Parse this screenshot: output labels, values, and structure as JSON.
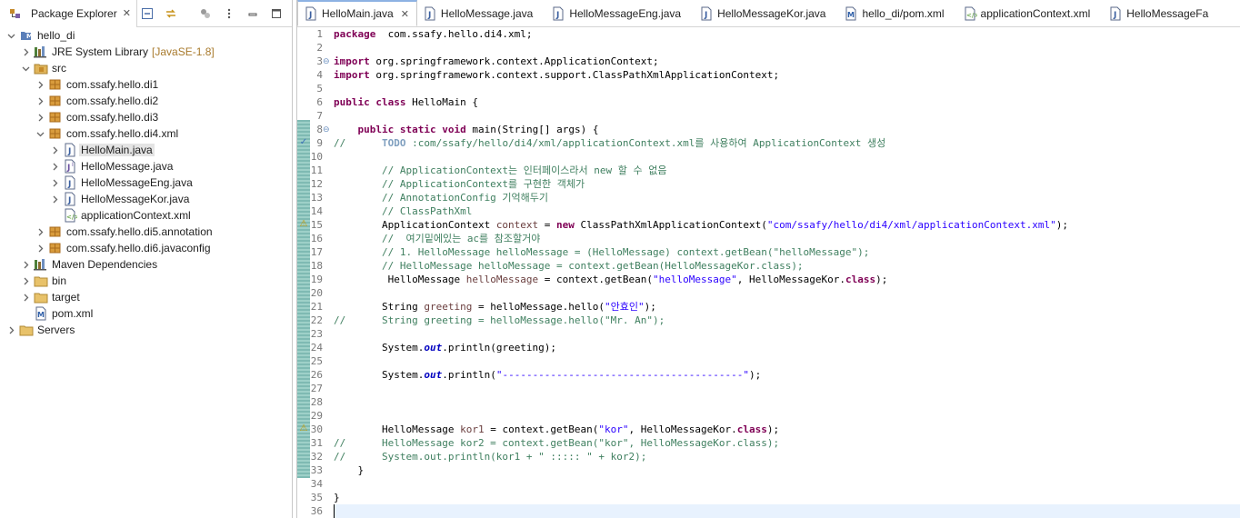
{
  "explorer": {
    "title": "Package Explorer",
    "tools": [
      "collapse-all-icon",
      "link-with-editor-icon",
      "filters-icon",
      "view-menu-icon",
      "minimize-icon",
      "maximize-icon"
    ]
  },
  "tree": [
    {
      "label": "hello_di",
      "icon": "maven-project-icon",
      "expanded": true,
      "depth": 0
    },
    {
      "label": "JRE System Library",
      "deco": "[JavaSE-1.8]",
      "icon": "library-icon",
      "expanded": false,
      "depth": 1
    },
    {
      "label": "src",
      "icon": "source-folder-icon",
      "expanded": true,
      "depth": 1
    },
    {
      "label": "com.ssafy.hello.di1",
      "icon": "package-icon",
      "expanded": false,
      "depth": 2
    },
    {
      "label": "com.ssafy.hello.di2",
      "icon": "package-icon",
      "expanded": false,
      "depth": 2
    },
    {
      "label": "com.ssafy.hello.di3",
      "icon": "package-icon",
      "expanded": false,
      "depth": 2
    },
    {
      "label": "com.ssafy.hello.di4.xml",
      "icon": "package-icon",
      "expanded": true,
      "depth": 2
    },
    {
      "label": "HelloMain.java",
      "icon": "java-file-icon",
      "expanded": false,
      "depth": 3,
      "selected": true
    },
    {
      "label": "HelloMessage.java",
      "icon": "java-interface-file-icon",
      "expanded": false,
      "depth": 3
    },
    {
      "label": "HelloMessageEng.java",
      "icon": "java-file-icon",
      "expanded": false,
      "depth": 3
    },
    {
      "label": "HelloMessageKor.java",
      "icon": "java-file-icon",
      "expanded": false,
      "depth": 3
    },
    {
      "label": "applicationContext.xml",
      "icon": "spring-xml-icon",
      "expanded": null,
      "depth": 3
    },
    {
      "label": "com.ssafy.hello.di5.annotation",
      "icon": "package-icon",
      "expanded": false,
      "depth": 2
    },
    {
      "label": "com.ssafy.hello.di6.javaconfig",
      "icon": "package-icon",
      "expanded": false,
      "depth": 2
    },
    {
      "label": "Maven Dependencies",
      "icon": "library-icon",
      "expanded": false,
      "depth": 1
    },
    {
      "label": "bin",
      "icon": "folder-icon",
      "expanded": false,
      "depth": 1
    },
    {
      "label": "target",
      "icon": "folder-icon",
      "expanded": false,
      "depth": 1
    },
    {
      "label": "pom.xml",
      "icon": "maven-pom-icon",
      "expanded": null,
      "depth": 1
    },
    {
      "label": "Servers",
      "icon": "folder-icon",
      "expanded": false,
      "depth": 0
    }
  ],
  "editor": {
    "tabs": [
      {
        "label": "HelloMain.java",
        "icon": "java-file-icon",
        "active": true
      },
      {
        "label": "HelloMessage.java",
        "icon": "java-file-icon"
      },
      {
        "label": "HelloMessageEng.java",
        "icon": "java-file-icon"
      },
      {
        "label": "HelloMessageKor.java",
        "icon": "java-file-icon"
      },
      {
        "label": "hello_di/pom.xml",
        "icon": "maven-pom-icon"
      },
      {
        "label": "applicationContext.xml",
        "icon": "spring-xml-icon"
      },
      {
        "label": "HelloMessageFa",
        "icon": "java-file-icon"
      }
    ],
    "close_glyph": "✕",
    "line_count": 36,
    "fold_lines": [
      3,
      8
    ],
    "warning_lines": [
      15,
      30
    ],
    "task_lines": [
      9
    ],
    "cursor_line": 36,
    "lines": [
      [
        [
          "kw",
          "package"
        ],
        [
          "",
          "  com.ssafy.hello.di4.xml;"
        ]
      ],
      [],
      [
        [
          "kw",
          "import"
        ],
        [
          "",
          " org.springframework.context.ApplicationContext;"
        ]
      ],
      [
        [
          "kw",
          "import"
        ],
        [
          "",
          " org.springframework.context.support.ClassPathXmlApplicationContext;"
        ]
      ],
      [],
      [
        [
          "kw",
          "public"
        ],
        [
          "",
          " "
        ],
        [
          "kw",
          "class"
        ],
        [
          "",
          " HelloMain {"
        ]
      ],
      [],
      [
        [
          "",
          "    "
        ],
        [
          "kw",
          "public"
        ],
        [
          "",
          " "
        ],
        [
          "kw",
          "static"
        ],
        [
          "",
          " "
        ],
        [
          "kw",
          "void"
        ],
        [
          "",
          " main(String[] args) {"
        ]
      ],
      [
        [
          "cm",
          "//      "
        ],
        [
          "todo",
          "TODO"
        ],
        [
          "cm",
          " :com/ssafy/hello/di4/xml/applicationContext.xml를 사용하여 ApplicationContext 생성"
        ]
      ],
      [],
      [
        [
          "cm",
          "        // ApplicationContext는 인터페이스라서 new 할 수 없음"
        ]
      ],
      [
        [
          "cm",
          "        // ApplicationContext를 구현한 객체가"
        ]
      ],
      [
        [
          "cm",
          "        // AnnotationConfig 기억해두기"
        ]
      ],
      [
        [
          "cm",
          "        // ClassPathXml"
        ]
      ],
      [
        [
          "",
          "        ApplicationContext "
        ],
        [
          "var",
          "context"
        ],
        [
          "",
          " = "
        ],
        [
          "kw",
          "new"
        ],
        [
          "",
          " ClassPathXmlApplicationContext("
        ],
        [
          "str",
          "\"com/ssafy/hello/di4/xml/applicationContext.xml\""
        ],
        [
          "",
          ");"
        ]
      ],
      [
        [
          "cm",
          "        //  여기밑에있는 ac를 참조할거야"
        ]
      ],
      [
        [
          "cm",
          "        // 1. HelloMessage helloMessage = (HelloMessage) context.getBean(\"helloMessage\");"
        ]
      ],
      [
        [
          "cm",
          "        // HelloMessage helloMessage = context.getBean(HelloMessageKor.class);"
        ]
      ],
      [
        [
          "",
          "         HelloMessage "
        ],
        [
          "var",
          "helloMessage"
        ],
        [
          "",
          " = context.getBean("
        ],
        [
          "str",
          "\"helloMessage\""
        ],
        [
          "",
          ", HelloMessageKor."
        ],
        [
          "kw",
          "class"
        ],
        [
          "",
          ");"
        ]
      ],
      [],
      [
        [
          "",
          "        String "
        ],
        [
          "var",
          "greeting"
        ],
        [
          "",
          " = helloMessage.hello("
        ],
        [
          "str",
          "\"안효인\""
        ],
        [
          "",
          ");"
        ]
      ],
      [
        [
          "cm",
          "//      String greeting = helloMessage.hello(\"Mr. An\");"
        ]
      ],
      [],
      [
        [
          "",
          "        System."
        ],
        [
          "fld",
          "out"
        ],
        [
          "",
          ".println(greeting);"
        ]
      ],
      [],
      [
        [
          "",
          "        System."
        ],
        [
          "fld",
          "out"
        ],
        [
          "",
          ".println("
        ],
        [
          "str",
          "\"----------------------------------------\""
        ],
        [
          "",
          ");"
        ]
      ],
      [],
      [],
      [],
      [
        [
          "",
          "        HelloMessage "
        ],
        [
          "var",
          "kor1"
        ],
        [
          "",
          " = context.getBean("
        ],
        [
          "str",
          "\"kor\""
        ],
        [
          "",
          ", HelloMessageKor."
        ],
        [
          "kw",
          "class"
        ],
        [
          "",
          ");"
        ]
      ],
      [
        [
          "cm",
          "//      HelloMessage kor2 = context.getBean(\"kor\", HelloMessageKor.class);"
        ]
      ],
      [
        [
          "cm",
          "//      System.out.println(kor1 + \" ::::: \" + kor2);"
        ]
      ],
      [
        [
          "",
          "    }"
        ]
      ],
      [],
      [
        [
          "",
          "}"
        ]
      ],
      []
    ]
  }
}
